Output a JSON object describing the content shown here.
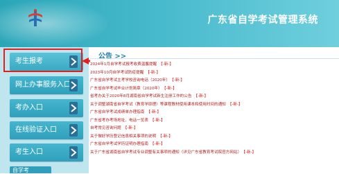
{
  "header": {
    "site_title": "广东省自学考试管理系统"
  },
  "sidebar": {
    "items": [
      {
        "label": "考生报考"
      },
      {
        "label": "网上办事服务入口"
      },
      {
        "label": "考办入口"
      },
      {
        "label": "在线验证入口"
      },
      {
        "label": "考生入口"
      }
    ],
    "partial_label": "自学考"
  },
  "notices": {
    "title": "公告 >>",
    "new_tag": "【-新-】",
    "items": [
      "2024年1月自学考试报考收费温馨提醒",
      "2023年10月自学考试防疫提醒",
      "广东省自学考试主考学校咨询电话（2020年）",
      "广东省自学考试毕业计划简章（2020年）",
      "省考办关于2020年8月湖南省自学考试新生注册工作的公告",
      "关于调整湖南省自学考试（教育学原理）等课程教材使用课本和使用时间的通知",
      "广东省自学考试成绩单办理指南",
      "广东省考办考场地址、电话一览表",
      "自考常见咨询问题",
      "关于做好学历登记信息相关事项的说明",
      "广东省自学考试学历证明办理指南",
      "关于广东省湖南省自学考试专业调整有关事项的通知（详见广东省教育考试院官方网站）"
    ]
  },
  "colors": {
    "header_start": "#2aa6b8",
    "header_end": "#6fcfdd",
    "sidebar_bg": "#bfe6ee",
    "button": "#2f9fbb",
    "notice_text": "#b32020",
    "highlight_border": "#e02020"
  }
}
